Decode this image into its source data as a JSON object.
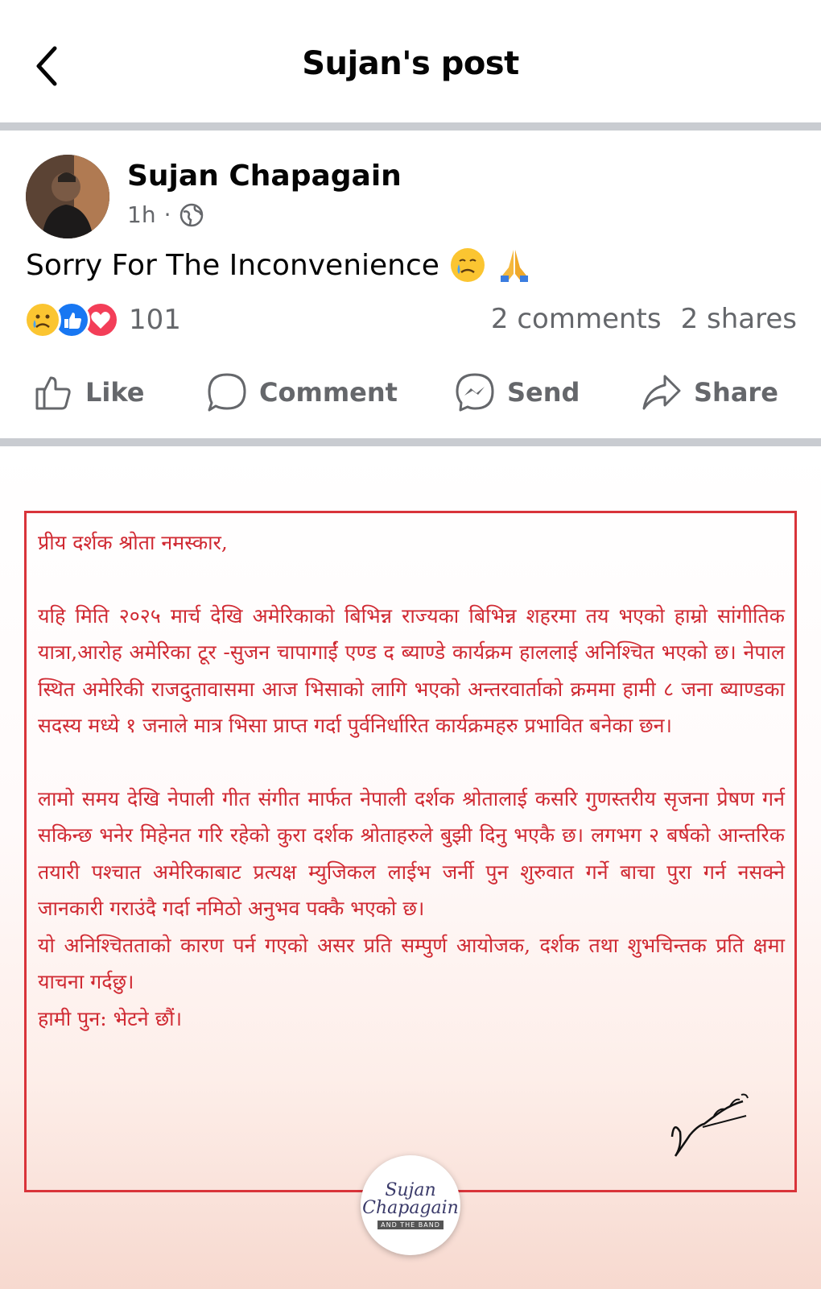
{
  "header": {
    "title": "Sujan's post"
  },
  "post": {
    "author": "Sujan Chapagain",
    "time": "1h",
    "separator": "·",
    "text": "Sorry For The Inconvenience",
    "reactions_count": "101",
    "comments": "2 comments",
    "shares": "2 shares"
  },
  "actions": {
    "like": "Like",
    "comment": "Comment",
    "send": "Send",
    "share": "Share"
  },
  "notice": {
    "greeting": "प्रीय दर्शक श्रोता नमस्कार,",
    "para1": "यहि मिति २०२५ मार्च देखि अमेरिकाको बिभिन्न राज्यका बिभिन्न शहरमा तय भएको हाम्रो सांगीतिक यात्रा,आरोह अमेरिका टूर -सुजन चापागाईं एण्ड द ब्याण्डे कार्यक्रम हाललाई अनिश्चित भएको छ। नेपाल स्थित अमेरिकी राजदुतावासमा आज भिसाको लागि भएको अन्तरवार्ताको क्रममा हामी ८ जना ब्याण्डका सदस्य मध्ये १ जनाले मात्र भिसा प्राप्त गर्दा पुर्वनिर्धारित कार्यक्रमहरु प्रभावित बनेका छन।",
    "para2": "लामो समय देखि नेपाली गीत संगीत मार्फत नेपाली दर्शक श्रोतालाई कसरि गुणस्तरीय सृजना प्रेषण गर्न सकिन्छ भनेर मिहेनत गरि रहेको कुरा दर्शक श्रोताहरुले बुझी दिनु भएकै छ। लगभग २ बर्षको आन्तरिक तयारी पश्चात अमेरिकाबाट प्रत्यक्ष म्युजिकल लाईभ जर्नी पुन शुरुवात गर्ने बाचा पुरा गर्न नसक्ने जानकारी गराउंदै गर्दा नमिठो अनुभव पक्कै भएको छ।",
    "para3": "यो अनिश्चितताको कारण पर्न गएको असर प्रति सम्पुर्ण आयोजक, दर्शक तथा शुभचिन्तक प्रति क्षमा याचना गर्दछु।",
    "closing": "हामी पुन: भेटने छौं।",
    "logo_name_1": "Sujan",
    "logo_name_2": "Chapagain",
    "logo_tagline": "AND THE BAND"
  },
  "colors": {
    "accent": "#d02a33",
    "like": "#1877f2",
    "love": "#f33e58",
    "muted": "#65676b"
  }
}
